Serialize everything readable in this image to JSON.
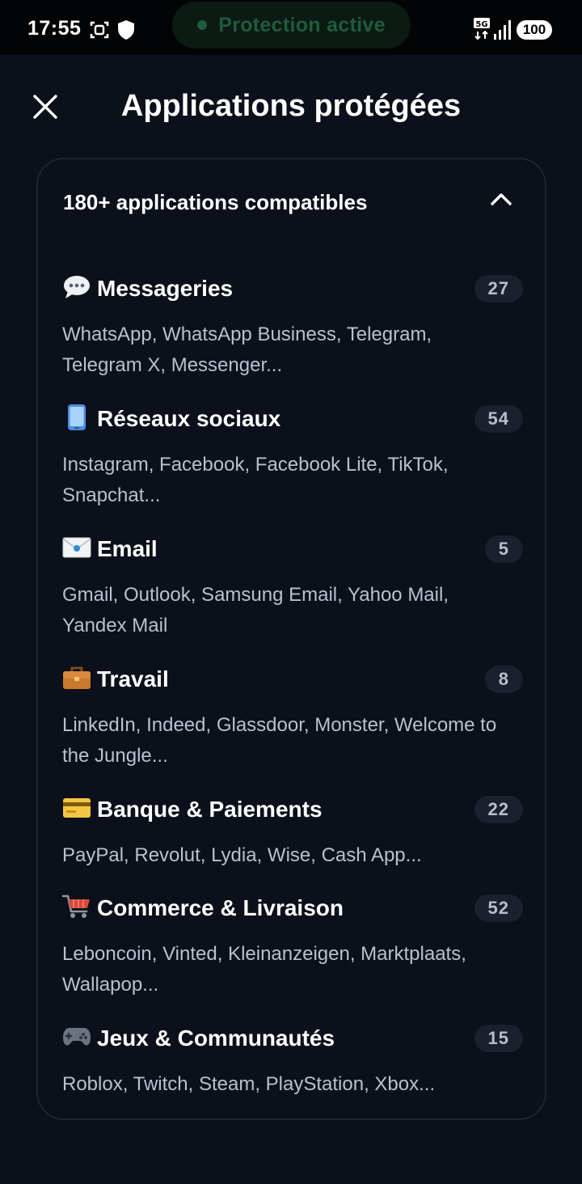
{
  "status_bar": {
    "time": "17:55",
    "protection_label": "Protection active",
    "network": "5G",
    "battery": "100"
  },
  "header": {
    "title": "Applications protégées",
    "close_icon": "close-icon"
  },
  "card": {
    "title": "180+ applications compatibles",
    "expanded": true,
    "categories": [
      {
        "icon": "speech-bubble-icon",
        "name": "Messageries",
        "count": "27",
        "apps": "WhatsApp, WhatsApp Business, Telegram, Telegram X, Messenger..."
      },
      {
        "icon": "mobile-phone-icon",
        "name": "Réseaux sociaux",
        "count": "54",
        "apps": "Instagram, Facebook, Facebook Lite, TikTok, Snapchat..."
      },
      {
        "icon": "envelope-icon",
        "name": "Email",
        "count": "5",
        "apps": "Gmail, Outlook, Samsung Email, Yahoo Mail, Yandex Mail"
      },
      {
        "icon": "briefcase-icon",
        "name": "Travail",
        "count": "8",
        "apps": "LinkedIn, Indeed, Glassdoor, Monster, Welcome to the Jungle..."
      },
      {
        "icon": "credit-card-icon",
        "name": "Banque & Paiements",
        "count": "22",
        "apps": "PayPal, Revolut, Lydia, Wise, Cash App..."
      },
      {
        "icon": "shopping-cart-icon",
        "name": "Commerce & Livraison",
        "count": "52",
        "apps": "Leboncoin, Vinted, Kleinanzeigen, Marktplaats, Wallapop..."
      },
      {
        "icon": "game-controller-icon",
        "name": "Jeux & Communautés",
        "count": "15",
        "apps": "Roblox, Twitch, Steam, PlayStation, Xbox..."
      }
    ]
  },
  "colors": {
    "background": "#0b101b",
    "card_border": "#1d2431",
    "badge_bg": "#1a212c",
    "protection_green": "#1f5b3d"
  }
}
